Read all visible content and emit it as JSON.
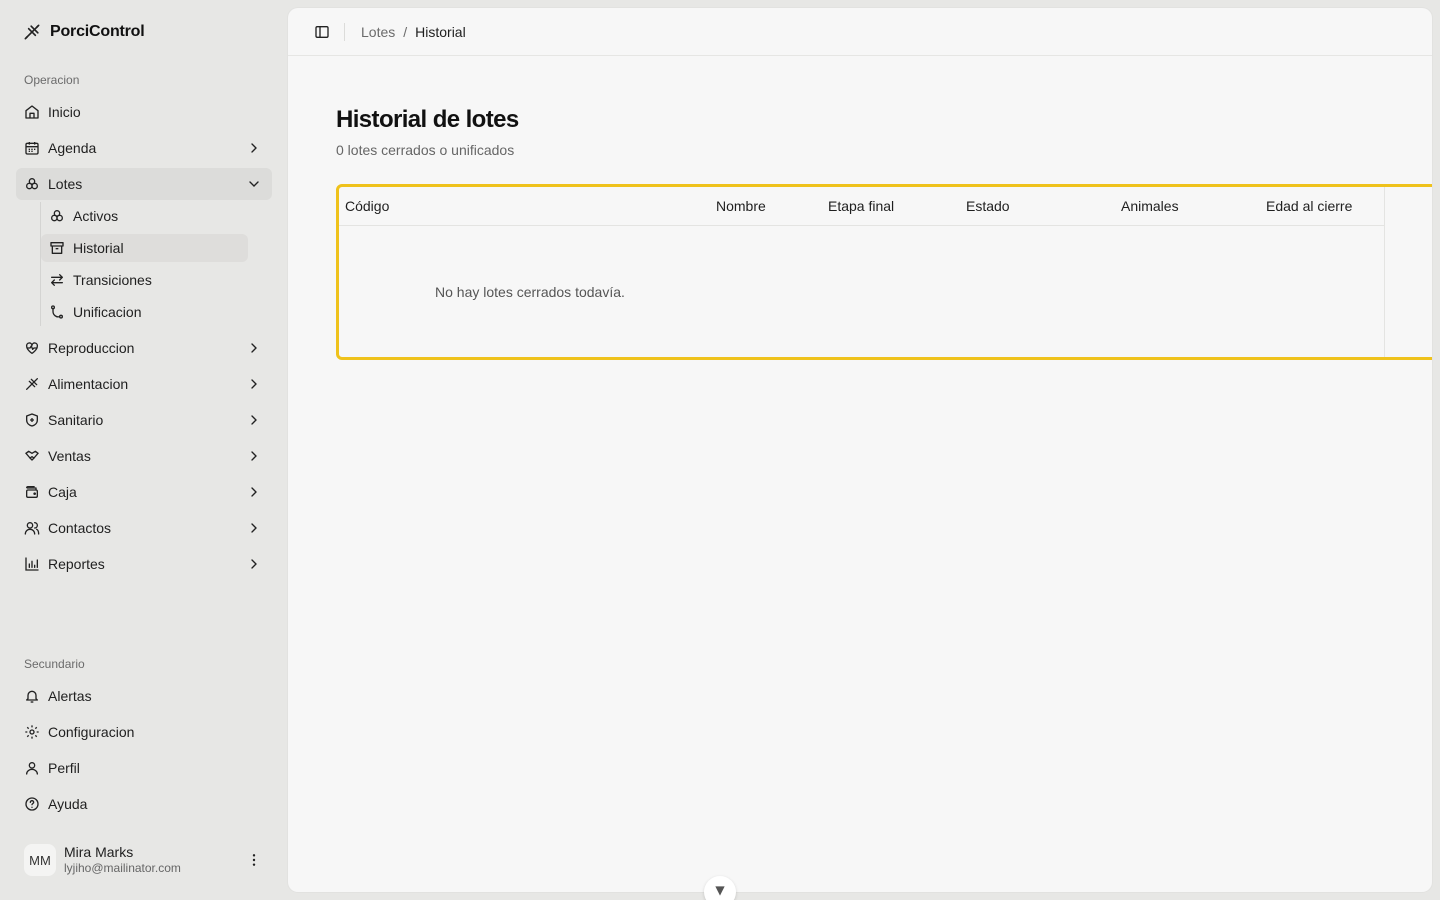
{
  "brand": {
    "name": "PorciControl",
    "icon": "pig-bone-icon"
  },
  "sidebar": {
    "group_operacion": "Operacion",
    "group_secundario": "Secundario",
    "items": [
      {
        "label": "Inicio",
        "icon": "home-icon"
      },
      {
        "label": "Agenda",
        "icon": "calendar-icon"
      },
      {
        "label": "Lotes",
        "icon": "lots-icon"
      },
      {
        "label": "Reproduccion",
        "icon": "heart-pulse-icon"
      },
      {
        "label": "Alimentacion",
        "icon": "feed-icon"
      },
      {
        "label": "Sanitario",
        "icon": "shield-icon"
      },
      {
        "label": "Ventas",
        "icon": "handshake-icon"
      },
      {
        "label": "Caja",
        "icon": "wallet-icon"
      },
      {
        "label": "Contactos",
        "icon": "users-icon"
      },
      {
        "label": "Reportes",
        "icon": "chart-icon"
      }
    ],
    "lotes_sub": [
      {
        "label": "Activos",
        "icon": "group-icon"
      },
      {
        "label": "Historial",
        "icon": "archive-icon"
      },
      {
        "label": "Transiciones",
        "icon": "arrows-icon"
      },
      {
        "label": "Unificacion",
        "icon": "merge-icon"
      }
    ],
    "secondary": [
      {
        "label": "Alertas",
        "icon": "bell-icon"
      },
      {
        "label": "Configuracion",
        "icon": "gear-icon"
      },
      {
        "label": "Perfil",
        "icon": "user-icon"
      },
      {
        "label": "Ayuda",
        "icon": "help-icon"
      }
    ],
    "user": {
      "initials": "MM",
      "name": "Mira Marks",
      "email": "lyjiho@mailinator.com"
    }
  },
  "breadcrumb": {
    "parent": "Lotes",
    "separator": "/",
    "current": "Historial"
  },
  "page": {
    "title": "Historial de lotes",
    "subtitle": "0 lotes cerrados o unificados"
  },
  "table": {
    "columns": [
      "Código",
      "Nombre",
      "Etapa final",
      "Estado",
      "Animales",
      "Edad al cierre"
    ],
    "rows": [],
    "empty_message": "No hay lotes cerrados todavía."
  },
  "colors": {
    "highlight": "#efc21b",
    "sidebar_bg": "#e7e7e5",
    "panel_bg": "#f7f7f7"
  }
}
